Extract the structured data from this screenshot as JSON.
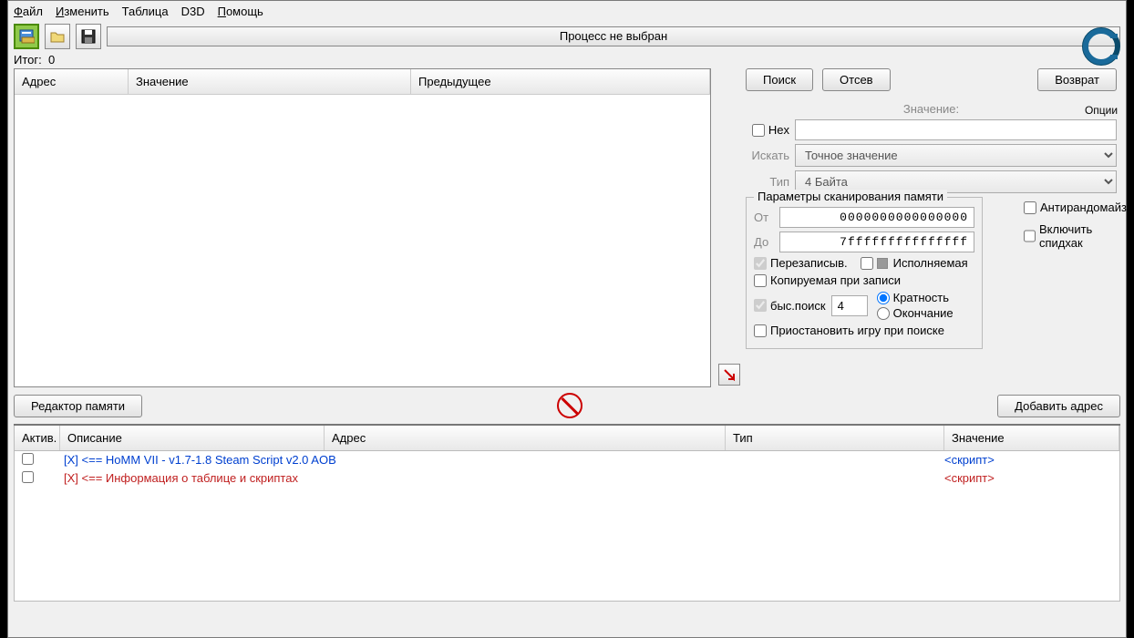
{
  "menu": {
    "file": "Файл",
    "edit": "Изменить",
    "table": "Таблица",
    "d3d": "D3D",
    "help": "Помощь"
  },
  "process_label": "Процесс не выбран",
  "options_label": "Опции",
  "itog_label": "Итог:",
  "itog_value": "0",
  "results_cols": {
    "addr": "Адрес",
    "value": "Значение",
    "prev": "Предыдущее"
  },
  "buttons": {
    "search": "Поиск",
    "filter": "Отсев",
    "undo": "Возврат",
    "memedit": "Редактор памяти",
    "addaddr": "Добавить адрес"
  },
  "labels": {
    "value": "Значение:",
    "hex": "Hex",
    "search_type": "Искать",
    "type": "Тип"
  },
  "dropdown": {
    "scan": "Точное значение",
    "vtype": "4 Байта"
  },
  "scan_params": {
    "legend": "Параметры сканирования памяти",
    "from": "От",
    "from_val": "0000000000000000",
    "to": "До",
    "to_val": "7fffffffffffffff",
    "rewritable": "Перезаписыв.",
    "executable": "Исполняемая",
    "copy_on_write": "Копируемая при записи",
    "fastscan": "быс.поиск",
    "fastscan_val": "4",
    "radio1": "Кратность",
    "radio2": "Окончание",
    "pause": "Приостановить игру при поиске"
  },
  "extra": {
    "antirand": "Антирандомайзер",
    "speedhack": "Включить спидхак"
  },
  "ct_cols": {
    "active": "Актив.",
    "desc": "Описание",
    "addr": "Адрес",
    "type": "Тип",
    "value": "Значение"
  },
  "ct_rows": [
    {
      "desc": "[X] <== HoMM VII - v1.7-1.8 Steam Script v2.0 AOB",
      "value": "<скрипт>",
      "color": "blue"
    },
    {
      "desc": "[X] <== Информация о таблице и скриптах",
      "value": "<скрипт>",
      "color": "red"
    }
  ]
}
